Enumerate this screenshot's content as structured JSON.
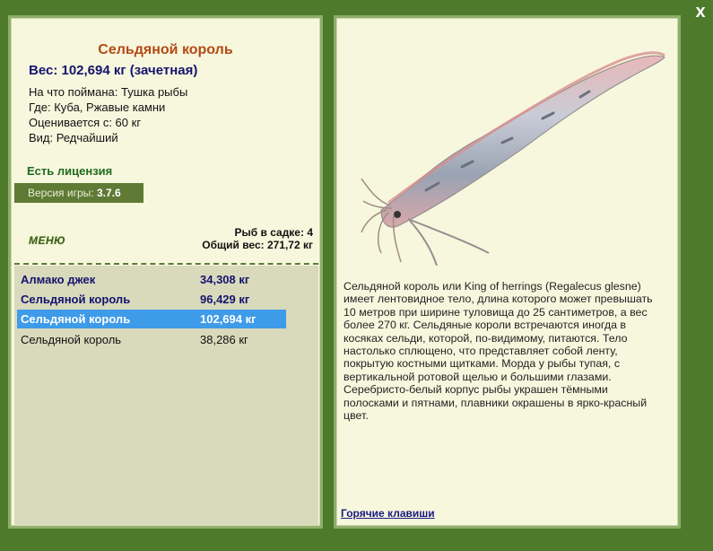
{
  "close": "x",
  "fish": {
    "name": "Сельдяной король",
    "weight_line": "Вес: 102,694 кг (зачетная)",
    "info": [
      "На что поймана: Тушка рыбы",
      "Где: Куба, Ржавые камни",
      "Оценивается с: 60 кг",
      "Вид: Редчайший"
    ]
  },
  "license": "Есть лицензия",
  "version": {
    "label": "Версия игры:",
    "value": "3.7.6"
  },
  "menu": "МЕНЮ",
  "keepnet": {
    "count_line": "Рыб в садке: 4",
    "total_line": "Общий вес: 271,72 кг"
  },
  "catches": [
    {
      "name": "Алмако джек",
      "weight": "34,308 кг",
      "style": "bold"
    },
    {
      "name": "Сельдяной король",
      "weight": "96,429 кг",
      "style": "bold"
    },
    {
      "name": "Сельдяной король",
      "weight": "102,694 кг",
      "style": "selected"
    },
    {
      "name": "Сельдяной король",
      "weight": "38,286 кг",
      "style": "plain"
    }
  ],
  "description": "Сельдяной король или King of herrings (Regalecus glesne) имеет лентовидное тело, длина которого может превышать 10 метров при ширине туловища до 25 сантиметров, а вес более 270 кг. Сельдяные короли встречаются иногда в косяках сельди, которой, по-видимому, питаются. Тело настолько сплющено, что представляет собой ленту, покрытую костными щитками. Морда у рыбы тупая, с вертикальной ротовой щелью и большими глазами. Серебристо-белый корпус рыбы украшен тёмными полосками и пятнами, плавники окрашены в ярко-красный цвет.",
  "hotkeys": "Горячие клавиши"
}
